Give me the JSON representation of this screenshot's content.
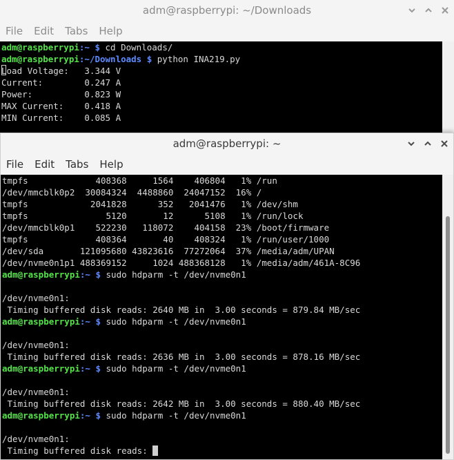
{
  "back_window": {
    "title": "adm@raspberrypi: ~/Downloads",
    "menu": [
      "File",
      "Edit",
      "Tabs",
      "Help"
    ],
    "lines": [
      {
        "user": "adm@raspberrypi",
        "path": ":~",
        "sym": " $ ",
        "cmd": "cd Downloads/"
      },
      {
        "user": "adm@raspberrypi",
        "path": ":~/Downloads",
        "sym": " $ ",
        "cmd": "python INA219.py"
      },
      {
        "text": "Load Voltage:   3.344 V"
      },
      {
        "text": "Current:        0.247 A"
      },
      {
        "text": "Power:          0.823 W"
      },
      {
        "text": "MAX Current:    0.418 A"
      },
      {
        "text": "MIN Current:    0.085 A"
      }
    ]
  },
  "front_window": {
    "title": "adm@raspberrypi: ~",
    "menu": [
      "File",
      "Edit",
      "Tabs",
      "Help"
    ],
    "lines": [
      {
        "text": "tmpfs             408368     1564    406804   1% /run"
      },
      {
        "text": "/dev/mmcblk0p2  30084324  4488860  24047152  16% /"
      },
      {
        "text": "tmpfs            2041828      352   2041476   1% /dev/shm"
      },
      {
        "text": "tmpfs               5120       12      5108   1% /run/lock"
      },
      {
        "text": "/dev/mmcblk0p1    522230   118072    404158  23% /boot/firmware"
      },
      {
        "text": "tmpfs             408364       40    408324   1% /run/user/1000"
      },
      {
        "text": "/dev/sda       121095680 43823616  77272064  37% /media/adm/UPAN"
      },
      {
        "text": "/dev/nvme0n1p1 488369152     1024 488368128   1% /media/adm/461A-8C96"
      },
      {
        "user": "adm@raspberrypi",
        "path": ":~",
        "sym": " $ ",
        "cmd": "sudo hdparm -t /dev/nvme0n1"
      },
      {
        "text": ""
      },
      {
        "text": "/dev/nvme0n1:"
      },
      {
        "text": " Timing buffered disk reads: 2640 MB in  3.00 seconds = 879.84 MB/sec"
      },
      {
        "user": "adm@raspberrypi",
        "path": ":~",
        "sym": " $ ",
        "cmd": "sudo hdparm -t /dev/nvme0n1"
      },
      {
        "text": ""
      },
      {
        "text": "/dev/nvme0n1:"
      },
      {
        "text": " Timing buffered disk reads: 2636 MB in  3.00 seconds = 878.16 MB/sec"
      },
      {
        "user": "adm@raspberrypi",
        "path": ":~",
        "sym": " $ ",
        "cmd": "sudo hdparm -t /dev/nvme0n1"
      },
      {
        "text": ""
      },
      {
        "text": "/dev/nvme0n1:"
      },
      {
        "text": " Timing buffered disk reads: 2642 MB in  3.00 seconds = 880.40 MB/sec"
      },
      {
        "user": "adm@raspberrypi",
        "path": ":~",
        "sym": " $ ",
        "cmd": "sudo hdparm -t /dev/nvme0n1"
      },
      {
        "text": ""
      },
      {
        "text": "/dev/nvme0n1:"
      },
      {
        "text": " Timing buffered disk reads: ",
        "cursor": true
      }
    ]
  },
  "colors": {
    "prompt_user": "#55e34a",
    "prompt_path": "#5d8bff",
    "terminal_bg": "#000000"
  },
  "icons": [
    "chevron-down-icon",
    "chevron-up-icon",
    "close-icon"
  ]
}
